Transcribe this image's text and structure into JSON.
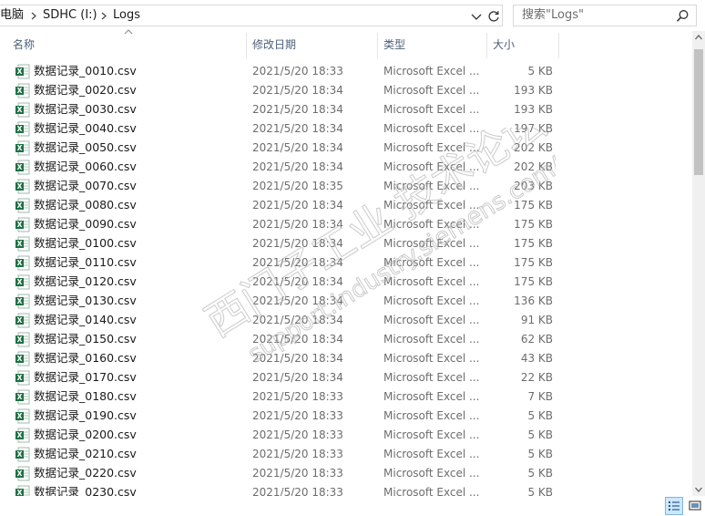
{
  "address": {
    "crumbs": [
      "电脑",
      "SDHC (I:)",
      "Logs"
    ]
  },
  "search": {
    "placeholder": "搜索\"Logs\""
  },
  "columns": {
    "name": "名称",
    "date": "修改日期",
    "type": "类型",
    "size": "大小"
  },
  "files": [
    {
      "name": "数据记录_0010.csv",
      "date": "2021/5/20 18:33",
      "type": "Microsoft Excel ...",
      "size": "5 KB"
    },
    {
      "name": "数据记录_0020.csv",
      "date": "2021/5/20 18:34",
      "type": "Microsoft Excel ...",
      "size": "193 KB"
    },
    {
      "name": "数据记录_0030.csv",
      "date": "2021/5/20 18:34",
      "type": "Microsoft Excel ...",
      "size": "193 KB"
    },
    {
      "name": "数据记录_0040.csv",
      "date": "2021/5/20 18:34",
      "type": "Microsoft Excel ...",
      "size": "197 KB"
    },
    {
      "name": "数据记录_0050.csv",
      "date": "2021/5/20 18:34",
      "type": "Microsoft Excel ...",
      "size": "202 KB"
    },
    {
      "name": "数据记录_0060.csv",
      "date": "2021/5/20 18:34",
      "type": "Microsoft Excel ...",
      "size": "202 KB"
    },
    {
      "name": "数据记录_0070.csv",
      "date": "2021/5/20 18:35",
      "type": "Microsoft Excel ...",
      "size": "203 KB"
    },
    {
      "name": "数据记录_0080.csv",
      "date": "2021/5/20 18:34",
      "type": "Microsoft Excel ...",
      "size": "175 KB"
    },
    {
      "name": "数据记录_0090.csv",
      "date": "2021/5/20 18:34",
      "type": "Microsoft Excel ...",
      "size": "175 KB"
    },
    {
      "name": "数据记录_0100.csv",
      "date": "2021/5/20 18:34",
      "type": "Microsoft Excel ...",
      "size": "175 KB"
    },
    {
      "name": "数据记录_0110.csv",
      "date": "2021/5/20 18:34",
      "type": "Microsoft Excel ...",
      "size": "175 KB"
    },
    {
      "name": "数据记录_0120.csv",
      "date": "2021/5/20 18:34",
      "type": "Microsoft Excel ...",
      "size": "175 KB"
    },
    {
      "name": "数据记录_0130.csv",
      "date": "2021/5/20 18:34",
      "type": "Microsoft Excel ...",
      "size": "136 KB"
    },
    {
      "name": "数据记录_0140.csv",
      "date": "2021/5/20 18:34",
      "type": "Microsoft Excel ...",
      "size": "91 KB"
    },
    {
      "name": "数据记录_0150.csv",
      "date": "2021/5/20 18:34",
      "type": "Microsoft Excel ...",
      "size": "62 KB"
    },
    {
      "name": "数据记录_0160.csv",
      "date": "2021/5/20 18:34",
      "type": "Microsoft Excel ...",
      "size": "43 KB"
    },
    {
      "name": "数据记录_0170.csv",
      "date": "2021/5/20 18:34",
      "type": "Microsoft Excel ...",
      "size": "22 KB"
    },
    {
      "name": "数据记录_0180.csv",
      "date": "2021/5/20 18:33",
      "type": "Microsoft Excel ...",
      "size": "7 KB"
    },
    {
      "name": "数据记录_0190.csv",
      "date": "2021/5/20 18:33",
      "type": "Microsoft Excel ...",
      "size": "5 KB"
    },
    {
      "name": "数据记录_0200.csv",
      "date": "2021/5/20 18:33",
      "type": "Microsoft Excel ...",
      "size": "5 KB"
    },
    {
      "name": "数据记录_0210.csv",
      "date": "2021/5/20 18:33",
      "type": "Microsoft Excel ...",
      "size": "5 KB"
    },
    {
      "name": "数据记录_0220.csv",
      "date": "2021/5/20 18:33",
      "type": "Microsoft Excel ...",
      "size": "5 KB"
    },
    {
      "name": "数据记录_0230.csv",
      "date": "2021/5/20 18:33",
      "type": "Microsoft Excel ...",
      "size": "5 KB"
    }
  ],
  "watermark": {
    "line1": "西门子工业 技术论坛",
    "line2": "support.industry.siemens.com/cs"
  },
  "icons": {
    "excel": "excel-csv-file-icon",
    "search": "search-icon",
    "refresh": "refresh-icon",
    "dropdown": "chevron-down-icon",
    "crumb_separator": "chevron-right-icon"
  },
  "colors": {
    "excel_green": "#1e7145",
    "header_text": "#4c607a",
    "secondary_text": "#6d6d6d",
    "selected_view": "#cce8ff"
  }
}
